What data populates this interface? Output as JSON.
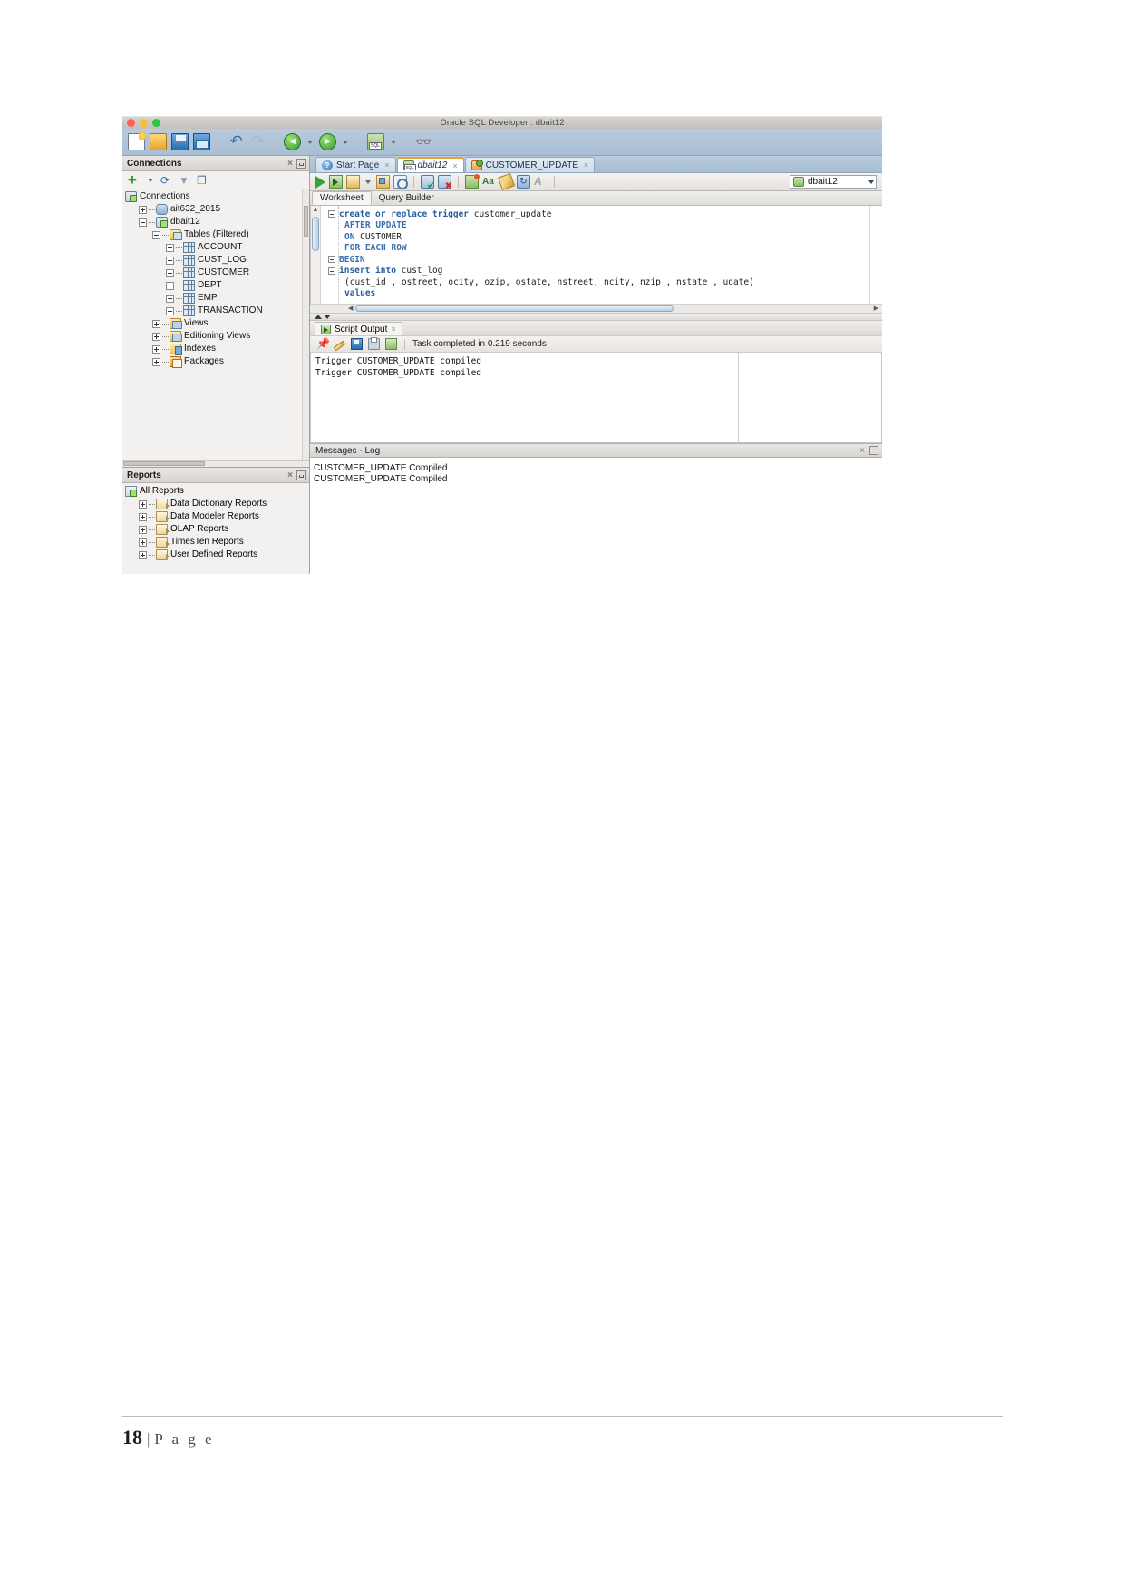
{
  "window": {
    "title": "Oracle SQL Developer : dbait12",
    "traffic_lights": [
      "close",
      "minimize",
      "maximize"
    ]
  },
  "main_toolbar": {
    "items": [
      {
        "name": "new-file-icon",
        "label": "New"
      },
      {
        "name": "open-file-icon",
        "label": "Open"
      },
      {
        "name": "save-icon",
        "label": "Save"
      },
      {
        "name": "save-all-icon",
        "label": "Save All"
      },
      {
        "name": "undo-icon",
        "label": "Undo"
      },
      {
        "name": "redo-icon",
        "label": "Redo"
      },
      {
        "name": "back-icon",
        "label": "Back"
      },
      {
        "name": "forward-icon",
        "label": "Forward"
      },
      {
        "name": "sql-worksheet-icon",
        "label": "SQL Worksheet"
      },
      {
        "name": "find-icon",
        "label": "Find"
      }
    ]
  },
  "connections_dock": {
    "title": "Connections",
    "close_glyph": "×",
    "toolbar": [
      {
        "name": "new-connection-icon",
        "label": "New Connection"
      },
      {
        "name": "refresh-icon",
        "label": "Refresh"
      },
      {
        "name": "filter-icon",
        "label": "Apply Filter"
      },
      {
        "name": "freeze-icon",
        "label": "Freeze View"
      }
    ],
    "tree": [
      {
        "label": "Connections",
        "indent": 0,
        "expander": "none",
        "icon": "connections-root-icon"
      },
      {
        "label": "ait632_2015",
        "indent": 1,
        "expander": "plus",
        "icon": "database-icon"
      },
      {
        "label": "dbait12",
        "indent": 1,
        "expander": "minus",
        "icon": "connection-icon"
      },
      {
        "label": "Tables (Filtered)",
        "indent": 2,
        "expander": "minus",
        "icon": "tables-folder-icon"
      },
      {
        "label": "ACCOUNT",
        "indent": 3,
        "expander": "plus",
        "icon": "table-icon"
      },
      {
        "label": "CUST_LOG",
        "indent": 3,
        "expander": "plus",
        "icon": "table-icon"
      },
      {
        "label": "CUSTOMER",
        "indent": 3,
        "expander": "plus",
        "icon": "table-icon"
      },
      {
        "label": "DEPT",
        "indent": 3,
        "expander": "plus",
        "icon": "table-icon"
      },
      {
        "label": "EMP",
        "indent": 3,
        "expander": "plus",
        "icon": "table-icon"
      },
      {
        "label": "TRANSACTION",
        "indent": 3,
        "expander": "plus",
        "icon": "table-icon"
      },
      {
        "label": "Views",
        "indent": 2,
        "expander": "plus",
        "icon": "views-folder-icon"
      },
      {
        "label": "Editioning Views",
        "indent": 2,
        "expander": "plus",
        "icon": "views-folder-icon"
      },
      {
        "label": "Indexes",
        "indent": 2,
        "expander": "plus",
        "icon": "indexes-folder-icon"
      },
      {
        "label": "Packages",
        "indent": 2,
        "expander": "plus",
        "icon": "packages-folder-icon"
      }
    ]
  },
  "reports_dock": {
    "title": "Reports",
    "close_glyph": "×",
    "tree": [
      {
        "label": "All Reports",
        "indent": 0,
        "expander": "none",
        "icon": "all-reports-icon"
      },
      {
        "label": "Data Dictionary Reports",
        "indent": 1,
        "expander": "plus",
        "icon": "report-folder-icon"
      },
      {
        "label": "Data Modeler Reports",
        "indent": 1,
        "expander": "plus",
        "icon": "report-folder-icon"
      },
      {
        "label": "OLAP Reports",
        "indent": 1,
        "expander": "plus",
        "icon": "report-folder-icon"
      },
      {
        "label": "TimesTen Reports",
        "indent": 1,
        "expander": "plus",
        "icon": "report-folder-icon"
      },
      {
        "label": "User Defined Reports",
        "indent": 1,
        "expander": "plus",
        "icon": "report-folder-icon"
      }
    ]
  },
  "editor_tabs": [
    {
      "label": "Start Page",
      "icon": "help-icon",
      "active": false,
      "closable": true
    },
    {
      "label": "dbait12",
      "icon": "sql-icon",
      "active": true,
      "closable": true
    },
    {
      "label": "CUSTOMER_UPDATE",
      "icon": "trigger-icon",
      "active": false,
      "closable": true
    }
  ],
  "worksheet_toolbar": {
    "items": [
      {
        "name": "run-statement-icon",
        "label": "Run Statement"
      },
      {
        "name": "run-script-icon",
        "label": "Run Script"
      },
      {
        "name": "explain-plan-icon",
        "label": "Explain Plan"
      },
      {
        "name": "autotrace-icon",
        "label": "Autotrace"
      },
      {
        "name": "sql-history-icon",
        "label": "SQL History"
      },
      {
        "name": "commit-icon",
        "label": "Commit"
      },
      {
        "name": "rollback-icon",
        "label": "Rollback"
      },
      {
        "name": "unshared-worksheet-icon",
        "label": "Unshared SQL Worksheet"
      },
      {
        "name": "to-upper-case-icon",
        "label": "To Upper/Lower/InitCap"
      },
      {
        "name": "clear-icon",
        "label": "Clear"
      },
      {
        "name": "sql-history-alt-icon",
        "label": "SQL History"
      },
      {
        "name": "font-size-icon",
        "label": "Font Size"
      }
    ],
    "connection": {
      "name": "dbait12",
      "icon": "sql-connection-icon"
    }
  },
  "worksheet_subtabs": [
    {
      "label": "Worksheet",
      "active": true
    },
    {
      "label": "Query Builder",
      "active": false
    }
  ],
  "code": {
    "lines": [
      {
        "fold": true,
        "indent": 0,
        "tokens": [
          {
            "t": "create or replace trigger ",
            "c": "kw"
          },
          {
            "t": "customer_update",
            "c": "pl"
          }
        ]
      },
      {
        "fold": false,
        "indent": 1,
        "tokens": [
          {
            "t": "AFTER UPDATE",
            "c": "kw2"
          }
        ]
      },
      {
        "fold": false,
        "indent": 1,
        "tokens": [
          {
            "t": "ON ",
            "c": "kw2"
          },
          {
            "t": "CUSTOMER",
            "c": "pl"
          }
        ]
      },
      {
        "fold": false,
        "indent": 1,
        "tokens": [
          {
            "t": "FOR EACH ROW",
            "c": "kw2"
          }
        ]
      },
      {
        "fold": true,
        "indent": 0,
        "tokens": [
          {
            "t": "BEGIN",
            "c": "kw2"
          }
        ]
      },
      {
        "fold": true,
        "indent": 0,
        "tokens": [
          {
            "t": "insert into ",
            "c": "kw"
          },
          {
            "t": "cust_log",
            "c": "pl"
          }
        ]
      },
      {
        "fold": false,
        "indent": 1,
        "tokens": [
          {
            "t": "(cust_id , ostreet, ocity, ozip, ostate, nstreet, ncity, nzip , nstate , udate)",
            "c": "pl"
          }
        ]
      },
      {
        "fold": false,
        "indent": 1,
        "tokens": [
          {
            "t": "values",
            "c": "kw"
          }
        ]
      }
    ]
  },
  "script_output": {
    "tab_label": "Script Output",
    "close_glyph": "×",
    "toolbar": [
      {
        "name": "pin-icon",
        "label": "Pin"
      },
      {
        "name": "clear-icon",
        "label": "Clear"
      },
      {
        "name": "save-icon",
        "label": "Save"
      },
      {
        "name": "print-icon",
        "label": "Print"
      },
      {
        "name": "text-output-icon",
        "label": "Text Output"
      }
    ],
    "status": "Task completed in 0.219 seconds",
    "lines": [
      "Trigger CUSTOMER_UPDATE compiled",
      "Trigger CUSTOMER_UPDATE compiled"
    ]
  },
  "messages_log": {
    "title": "Messages - Log",
    "close_glyph": "×",
    "lines": [
      "CUSTOMER_UPDATE Compiled",
      "CUSTOMER_UPDATE Compiled"
    ]
  },
  "page_footer": {
    "number": "18",
    "separator": "|",
    "word": "P a g e"
  },
  "colors": {
    "toolbar_blue": "#a9bed3",
    "accent_orange": "#e8a13a",
    "keyword_blue": "#2a5d9e",
    "green_run": "#39a139"
  }
}
